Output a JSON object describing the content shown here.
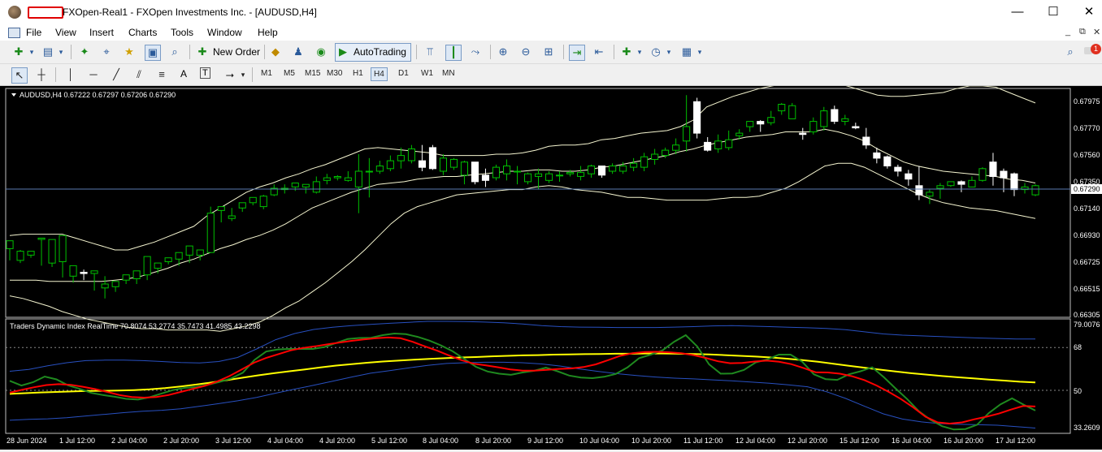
{
  "window": {
    "title": "FXOpen-Real1 - FXOpen Investments Inc. - [AUDUSD,H4]",
    "minimize": "—",
    "maximize": "☐",
    "close": "✕"
  },
  "menu": {
    "items": [
      "File",
      "View",
      "Insert",
      "Charts",
      "Tools",
      "Window",
      "Help"
    ]
  },
  "toolbar": {
    "new_order": "New Order",
    "autotrading": "AutoTrading",
    "notification_count": "1"
  },
  "drawing_tools": {
    "text_tool": "A",
    "text_label_tool": "T"
  },
  "timeframes": [
    "M1",
    "M5",
    "M15",
    "M30",
    "H1",
    "H4",
    "D1",
    "W1",
    "MN"
  ],
  "active_timeframe": "H4",
  "colors": {
    "bull": "#00c000",
    "bear": "#ffffff",
    "bands": "#f5f5d0",
    "tdi_green": "#1f8a1f",
    "tdi_red": "#ff0000",
    "tdi_yellow": "#ffff00",
    "tdi_blue": "#2850c0"
  },
  "chart": {
    "header": "AUDUSD,H4  0.67222 0.67297 0.67206 0.67290",
    "current_price_label": "0.67290",
    "price_axis": [
      "0.67975",
      "0.67770",
      "0.67560",
      "0.67350",
      "0.67140",
      "0.66930",
      "0.66725",
      "0.66515",
      "0.66305"
    ],
    "time_axis": [
      "28 Jun 2024",
      "1 Jul 12:00",
      "2 Jul 04:00",
      "2 Jul 20:00",
      "3 Jul 12:00",
      "4 Jul 04:00",
      "4 Jul 20:00",
      "5 Jul 12:00",
      "8 Jul 04:00",
      "8 Jul 20:00",
      "9 Jul 12:00",
      "10 Jul 04:00",
      "10 Jul 20:00",
      "11 Jul 12:00",
      "12 Jul 04:00",
      "12 Jul 20:00",
      "15 Jul 12:00",
      "16 Jul 04:00",
      "16 Jul 20:00",
      "17 Jul 12:00"
    ]
  },
  "indicator": {
    "header": "Traders Dynamic Index RealTime 70.8074 53.2774 35.7473 41.4985 43.2298",
    "axis": [
      "79.0076",
      "68",
      "50",
      "33.2609"
    ]
  },
  "chart_data": {
    "type": "candlestick",
    "symbol": "AUDUSD",
    "timeframe": "H4",
    "ylim": [
      0.66305,
      0.68
    ],
    "candles": [
      [
        0.6681,
        0.6687,
        0.6677,
        0.6672
      ],
      [
        0.6672,
        0.6679,
        0.668,
        0.667
      ],
      [
        0.6676,
        0.6679,
        0.6675,
        0.6674
      ],
      [
        0.6688,
        0.6689,
        0.6688,
        0.6668
      ],
      [
        0.667,
        0.6688,
        0.6683,
        0.6667
      ],
      [
        0.6671,
        0.6691,
        0.667,
        0.6659
      ],
      [
        0.666,
        0.6668,
        0.6662,
        0.6655
      ],
      [
        0.6663,
        0.6662,
        0.6665,
        0.6657
      ],
      [
        0.6662,
        0.6664,
        0.6653,
        0.6649
      ],
      [
        0.6651,
        0.6654,
        0.666,
        0.6643
      ],
      [
        0.6652,
        0.6656,
        0.6652,
        0.6648
      ],
      [
        0.6657,
        0.6661,
        0.6655,
        0.6654
      ],
      [
        0.6658,
        0.6664,
        0.6663,
        0.6654
      ],
      [
        0.6661,
        0.6675,
        0.6664,
        0.6657
      ],
      [
        0.6666,
        0.667,
        0.667,
        0.6662
      ],
      [
        0.6671,
        0.6674,
        0.6674,
        0.6669
      ],
      [
        0.6673,
        0.6678,
        0.6678,
        0.6668
      ],
      [
        0.6676,
        0.6683,
        0.6679,
        0.667
      ],
      [
        0.6676,
        0.668,
        0.668,
        0.6672
      ],
      [
        0.6678,
        0.6708,
        0.6713,
        0.6678
      ],
      [
        0.671,
        0.6713,
        0.671,
        0.6701
      ],
      [
        0.6704,
        0.6706,
        0.6712,
        0.6702
      ],
      [
        0.6712,
        0.6716,
        0.6713,
        0.6709
      ],
      [
        0.6716,
        0.672,
        0.6718,
        0.6714
      ],
      [
        0.6713,
        0.6721,
        0.6722,
        0.6711
      ],
      [
        0.6722,
        0.6727,
        0.673,
        0.6721
      ],
      [
        0.6726,
        0.6727,
        0.673,
        0.6723
      ],
      [
        0.6728,
        0.6731,
        0.673,
        0.6725
      ],
      [
        0.6728,
        0.673,
        0.6728,
        0.6723
      ],
      [
        0.6724,
        0.6732,
        0.6736,
        0.6723
      ],
      [
        0.6733,
        0.6735,
        0.6738,
        0.673
      ],
      [
        0.6735,
        0.6736,
        0.6737,
        0.6733
      ],
      [
        0.6733,
        0.6735,
        0.674,
        0.6732
      ],
      [
        0.6728,
        0.674,
        0.6753,
        0.6708
      ],
      [
        0.674,
        0.674,
        0.675,
        0.672
      ],
      [
        0.674,
        0.6744,
        0.6748,
        0.6738
      ],
      [
        0.6742,
        0.6748,
        0.6752,
        0.674
      ],
      [
        0.6748,
        0.6752,
        0.6758,
        0.6742
      ],
      [
        0.6748,
        0.6757,
        0.676,
        0.6746
      ],
      [
        0.6748,
        0.6743,
        0.676,
        0.674
      ],
      [
        0.6758,
        0.6742,
        0.676,
        0.6741
      ],
      [
        0.674,
        0.675,
        0.6753,
        0.6737
      ],
      [
        0.6743,
        0.6749,
        0.675,
        0.6741
      ],
      [
        0.6737,
        0.6747,
        0.6748,
        0.673
      ],
      [
        0.6747,
        0.6732,
        0.6747,
        0.673
      ],
      [
        0.6737,
        0.6733,
        0.6742,
        0.6728
      ],
      [
        0.6735,
        0.6743,
        0.6745,
        0.6733
      ],
      [
        0.6738,
        0.6744,
        0.6749,
        0.6733
      ],
      [
        0.674,
        0.674,
        0.6744,
        0.673
      ],
      [
        0.6732,
        0.6738,
        0.6739,
        0.673
      ],
      [
        0.6736,
        0.6738,
        0.6742,
        0.6726
      ],
      [
        0.6733,
        0.6738,
        0.674,
        0.6731
      ],
      [
        0.6737,
        0.6737,
        0.674,
        0.6732
      ],
      [
        0.6738,
        0.6739,
        0.6741,
        0.6736
      ],
      [
        0.6736,
        0.6739,
        0.6744,
        0.6733
      ],
      [
        0.6738,
        0.6744,
        0.6745,
        0.6735
      ],
      [
        0.6744,
        0.6737,
        0.6744,
        0.6735
      ],
      [
        0.674,
        0.6744,
        0.6746,
        0.6738
      ],
      [
        0.674,
        0.6744,
        0.6747,
        0.6738
      ],
      [
        0.6743,
        0.6746,
        0.675,
        0.674
      ],
      [
        0.6743,
        0.6751,
        0.6754,
        0.674
      ],
      [
        0.6749,
        0.6753,
        0.6757,
        0.6745
      ],
      [
        0.6752,
        0.6756,
        0.6758,
        0.675
      ],
      [
        0.6756,
        0.676,
        0.6765,
        0.6753
      ],
      [
        0.6763,
        0.6774,
        0.6798,
        0.6755
      ],
      [
        0.6793,
        0.6769,
        0.6796,
        0.6765
      ],
      [
        0.6762,
        0.6756,
        0.6766,
        0.6755
      ],
      [
        0.6757,
        0.6763,
        0.6768,
        0.6754
      ],
      [
        0.6758,
        0.6764,
        0.6771,
        0.6756
      ],
      [
        0.6767,
        0.6769,
        0.6772,
        0.6764
      ],
      [
        0.6774,
        0.6778,
        0.6778,
        0.677
      ],
      [
        0.6778,
        0.6776,
        0.6779,
        0.677
      ],
      [
        0.6777,
        0.6781,
        0.6786,
        0.6775
      ],
      [
        0.6786,
        0.6791,
        0.6792,
        0.6783
      ],
      [
        0.678,
        0.679,
        0.6792,
        0.678
      ],
      [
        0.6769,
        0.6768,
        0.6773,
        0.6764
      ],
      [
        0.677,
        0.6778,
        0.6781,
        0.6768
      ],
      [
        0.6774,
        0.6786,
        0.6789,
        0.6771
      ],
      [
        0.6787,
        0.6778,
        0.679,
        0.6776
      ],
      [
        0.6778,
        0.678,
        0.6783,
        0.6775
      ],
      [
        0.6774,
        0.6773,
        0.6777,
        0.6772
      ],
      [
        0.6766,
        0.676,
        0.6773,
        0.6757
      ],
      [
        0.6754,
        0.675,
        0.6758,
        0.6746
      ],
      [
        0.6751,
        0.6744,
        0.6752,
        0.6742
      ],
      [
        0.6743,
        0.674,
        0.6745,
        0.6736
      ],
      [
        0.6738,
        0.6734,
        0.6741,
        0.6729
      ],
      [
        0.6729,
        0.6722,
        0.6744,
        0.6718
      ],
      [
        0.6721,
        0.6724,
        0.6726,
        0.6715
      ],
      [
        0.6727,
        0.6729,
        0.6731,
        0.6719
      ],
      [
        0.6729,
        0.6732,
        0.6732,
        0.6728
      ],
      [
        0.6732,
        0.673,
        0.6733,
        0.6724
      ],
      [
        0.6728,
        0.6733,
        0.6736,
        0.6728
      ],
      [
        0.6733,
        0.6742,
        0.6743,
        0.6732
      ],
      [
        0.6747,
        0.6736,
        0.6754,
        0.6729
      ],
      [
        0.674,
        0.6735,
        0.6742,
        0.6724
      ],
      [
        0.6738,
        0.6726,
        0.6739,
        0.6721
      ],
      [
        0.6726,
        0.6728,
        0.6731,
        0.6723
      ],
      [
        0.6722,
        0.6729,
        0.673,
        0.6721
      ]
    ],
    "bollinger_upper": [
      0.6691,
      0.6692,
      0.6692,
      0.6692,
      0.6692,
      0.6689,
      0.6686,
      0.6683,
      0.668,
      0.668,
      0.6683,
      0.6686,
      0.669,
      0.6694,
      0.6698,
      0.6706,
      0.6712,
      0.6718,
      0.6724,
      0.6728,
      0.6731,
      0.6735,
      0.6738,
      0.6742,
      0.6745,
      0.6749,
      0.6753,
      0.6757,
      0.6758,
      0.6757,
      0.6756,
      0.6755,
      0.6754,
      0.6752,
      0.6752,
      0.6752,
      0.6752,
      0.6753,
      0.6753,
      0.6754,
      0.6756,
      0.6759,
      0.676,
      0.676,
      0.6761,
      0.6764,
      0.6765,
      0.6767,
      0.6769,
      0.677,
      0.6771,
      0.6774,
      0.6779,
      0.6789,
      0.6793,
      0.6797,
      0.68,
      0.6803,
      0.6805,
      0.6807,
      0.6806,
      0.6806,
      0.6807,
      0.6807,
      0.6804,
      0.6801,
      0.6798,
      0.6797,
      0.6797,
      0.6798,
      0.6799,
      0.68,
      0.6803,
      0.6805,
      0.6805,
      0.6804,
      0.68,
      0.6796,
      0.6792
    ],
    "bollinger_middle": [
      0.6657,
      0.6657,
      0.6657,
      0.6656,
      0.6656,
      0.6656,
      0.6656,
      0.6656,
      0.6657,
      0.6658,
      0.666,
      0.6663,
      0.6666,
      0.667,
      0.6673,
      0.6677,
      0.6681,
      0.6684,
      0.6688,
      0.6691,
      0.6695,
      0.67,
      0.6706,
      0.6712,
      0.6716,
      0.672,
      0.6724,
      0.6727,
      0.673,
      0.6731,
      0.6732,
      0.6734,
      0.6735,
      0.6736,
      0.6736,
      0.6737,
      0.6738,
      0.6739,
      0.674,
      0.674,
      0.6741,
      0.6741,
      0.674,
      0.674,
      0.6741,
      0.6743,
      0.6744,
      0.6746,
      0.6748,
      0.675,
      0.6752,
      0.6755,
      0.6757,
      0.676,
      0.6762,
      0.6764,
      0.6766,
      0.6767,
      0.6768,
      0.677,
      0.677,
      0.677,
      0.6772,
      0.677,
      0.6767,
      0.6763,
      0.6757,
      0.6752,
      0.6747,
      0.6744,
      0.6742,
      0.674,
      0.6739,
      0.6738,
      0.6737,
      0.6736,
      0.6734,
      0.6733,
      0.6731
    ],
    "bollinger_lower": [
      0.6645,
      0.6643,
      0.664,
      0.6637,
      0.6633,
      0.663,
      0.6627,
      0.6625,
      0.6623,
      0.6621,
      0.662,
      0.662,
      0.6619,
      0.6619,
      0.6619,
      0.6619,
      0.6618,
      0.662,
      0.6622,
      0.6625,
      0.663,
      0.6636,
      0.6641,
      0.6648,
      0.6655,
      0.6663,
      0.6671,
      0.668,
      0.669,
      0.67,
      0.6708,
      0.6713,
      0.6716,
      0.6719,
      0.6722,
      0.6723,
      0.6724,
      0.6725,
      0.6726,
      0.6726,
      0.6728,
      0.6729,
      0.6728,
      0.6726,
      0.6725,
      0.6724,
      0.6722,
      0.672,
      0.672,
      0.6719,
      0.6718,
      0.6718,
      0.6718,
      0.6718,
      0.6719,
      0.672,
      0.672,
      0.6721,
      0.6724,
      0.6727,
      0.6732,
      0.6738,
      0.6744,
      0.6746,
      0.6746,
      0.6743,
      0.6738,
      0.6733,
      0.6728,
      0.6723,
      0.6719,
      0.6716,
      0.6714,
      0.6712,
      0.6711,
      0.671,
      0.6708,
      0.6706,
      0.6704
    ],
    "tdi": {
      "ylim": [
        33.2609,
        79.0076
      ],
      "levels": [
        68,
        50
      ],
      "rsi_price_line": [
        54.0,
        52.0,
        53.4,
        55.8,
        54.6,
        52.1,
        50.6,
        48.9,
        48.0,
        47.3,
        46.4,
        46.1,
        47.1,
        48.6,
        50.1,
        51.0,
        51.4,
        52.3,
        53.5,
        55.0,
        57.4,
        62.8,
        66.3,
        67.2,
        67.4,
        67.4,
        67.4,
        68.2,
        69.9,
        71.6,
        72.0,
        72.1,
        73.2,
        73.9,
        73.6,
        72.5,
        70.9,
        68.9,
        66.4,
        63.2,
        59.9,
        57.9,
        57.0,
        56.5,
        57.5,
        58.2,
        59.5,
        58.0,
        56.2,
        55.4,
        55.1,
        55.7,
        56.9,
        59.6,
        63.5,
        65.0,
        66.8,
        70.4,
        73.2,
        68.4,
        60.9,
        57.0,
        57.1,
        58.6,
        61.7,
        63.0,
        65.0,
        65.0,
        62.0,
        56.7,
        54.7,
        54.4,
        56.7,
        58.0,
        59.7,
        55.5,
        50.8,
        46.3,
        41.2,
        37.6,
        34.9,
        33.5,
        33.7,
        35.5,
        40.4,
        44.1,
        46.6,
        43.9,
        41.5
      ],
      "trade_signal_line": [
        49.0,
        50.2,
        51.3,
        52.2,
        52.6,
        52.3,
        51.5,
        50.5,
        49.3,
        48.0,
        47.2,
        46.9,
        47.2,
        48.0,
        49.3,
        50.6,
        51.9,
        53.7,
        56.0,
        58.8,
        61.6,
        63.6,
        65.2,
        66.8,
        67.8,
        68.5,
        69.3,
        70.1,
        70.8,
        71.4,
        71.9,
        72.2,
        71.9,
        70.4,
        68.5,
        66.7,
        64.6,
        62.7,
        61.2,
        60.5,
        59.7,
        58.8,
        58.3,
        58.3,
        58.6,
        59.0,
        59.2,
        59.8,
        60.9,
        62.7,
        64.5,
        65.6,
        66.1,
        66.2,
        66.0,
        65.6,
        64.8,
        63.6,
        62.2,
        61.4,
        61.5,
        62.1,
        62.5,
        62.0,
        61.0,
        59.4,
        57.6,
        57.5,
        57.0,
        55.9,
        54.3,
        52.0,
        49.3,
        46.3,
        42.8,
        38.9,
        36.5,
        36.0,
        36.5,
        37.8,
        38.9,
        40.2,
        41.9,
        43.4,
        43.2
      ],
      "market_base_line": [
        48.5,
        48.8,
        49.1,
        49.3,
        49.5,
        49.7,
        49.8,
        49.9,
        50.1,
        50.4,
        50.9,
        51.6,
        52.4,
        53.3,
        54.3,
        55.3,
        56.3,
        57.2,
        58.0,
        58.8,
        59.6,
        60.4,
        61.0,
        61.6,
        62.1,
        62.5,
        62.9,
        63.2,
        63.5,
        63.8,
        64.0,
        64.3,
        64.5,
        64.7,
        64.8,
        65.0,
        65.1,
        65.2,
        65.3,
        65.4,
        65.4,
        65.5,
        65.5,
        65.4,
        65.3,
        65.1,
        64.8,
        64.5,
        64.2,
        63.8,
        63.3,
        62.7,
        62.0,
        61.2,
        60.3,
        59.5,
        58.7,
        57.9,
        57.2,
        56.6,
        56.0,
        55.5,
        55.0,
        54.5,
        54.1,
        53.6,
        53.3
      ],
      "volatility_upper": [
        58.0,
        58.8,
        60.3,
        61.6,
        62.5,
        62.7,
        62.7,
        62.5,
        62.1,
        61.7,
        61.5,
        62.1,
        63.8,
        67.4,
        71.3,
        73.9,
        75.6,
        76.5,
        77.2,
        77.7,
        78.2,
        78.6,
        79.0,
        79.0,
        78.9,
        78.7,
        78.4,
        77.9,
        77.2,
        76.8,
        76.6,
        76.5,
        76.4,
        76.4,
        76.4,
        76.6,
        76.8,
        77.1,
        77.2,
        77.0,
        76.8,
        76.5,
        76.3,
        76.0,
        75.5,
        74.6,
        73.7,
        73.2,
        72.9,
        72.6,
        72.3,
        72.0,
        71.8,
        71.6,
        71.6
      ],
      "volatility_lower": [
        37.4,
        37.8,
        38.0,
        38.5,
        39.2,
        39.9,
        40.6,
        41.2,
        41.6,
        42.2,
        43.3,
        44.4,
        45.6,
        47.0,
        48.8,
        50.5,
        52.1,
        53.8,
        55.6,
        57.2,
        58.3,
        59.4,
        60.5,
        61.3,
        61.6,
        61.8,
        61.8,
        61.6,
        61.1,
        60.2,
        59.0,
        57.9,
        57.0,
        56.2,
        55.6,
        55.1,
        54.8,
        54.4,
        54.0,
        53.5,
        53.0,
        52.3,
        51.5,
        49.4,
        46.6,
        43.3,
        40.1,
        37.9,
        36.7,
        36.0,
        35.7,
        35.5,
        35.3,
        34.7,
        34.1
      ]
    }
  }
}
